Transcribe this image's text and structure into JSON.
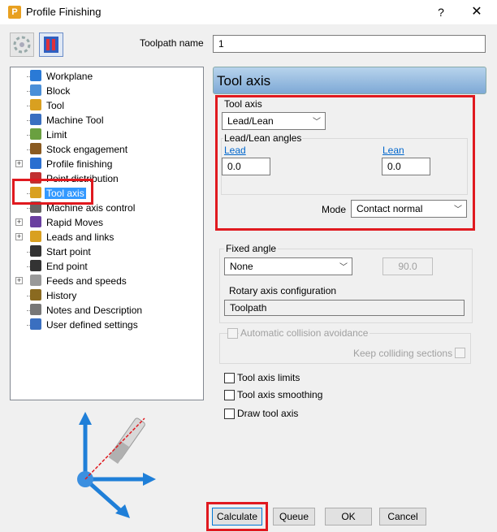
{
  "window": {
    "title": "Profile Finishing",
    "help_label": "?",
    "close_label": "✕",
    "app_icon_letter": "P"
  },
  "toolpath_name": {
    "label": "Toolpath name",
    "value": "1"
  },
  "tree": {
    "items": [
      {
        "label": "Workplane",
        "icon": "workplane-icon",
        "expandable": false
      },
      {
        "label": "Block",
        "icon": "block-icon",
        "expandable": false
      },
      {
        "label": "Tool",
        "icon": "tool-icon",
        "expandable": false
      },
      {
        "label": "Machine Tool",
        "icon": "machine-tool-icon",
        "expandable": false
      },
      {
        "label": "Limit",
        "icon": "limit-icon",
        "expandable": false
      },
      {
        "label": "Stock engagement",
        "icon": "stock-engagement-icon",
        "expandable": false
      },
      {
        "label": "Profile finishing",
        "icon": "profile-finishing-icon",
        "expandable": true
      },
      {
        "label": "Point distribution",
        "icon": "point-distribution-icon",
        "expandable": false
      },
      {
        "label": "Tool axis",
        "icon": "tool-axis-icon",
        "expandable": false,
        "selected": true
      },
      {
        "label": "Machine axis control",
        "icon": "machine-axis-control-icon",
        "expandable": false
      },
      {
        "label": "Rapid Moves",
        "icon": "rapid-moves-icon",
        "expandable": true
      },
      {
        "label": "Leads and links",
        "icon": "leads-links-icon",
        "expandable": true
      },
      {
        "label": "Start point",
        "icon": "start-point-icon",
        "expandable": false
      },
      {
        "label": "End point",
        "icon": "end-point-icon",
        "expandable": false
      },
      {
        "label": "Feeds and speeds",
        "icon": "feeds-speeds-icon",
        "expandable": true
      },
      {
        "label": "History",
        "icon": "history-icon",
        "expandable": false
      },
      {
        "label": "Notes and Description",
        "icon": "notes-icon",
        "expandable": false
      },
      {
        "label": "User defined settings",
        "icon": "user-settings-icon",
        "expandable": false
      }
    ]
  },
  "panel": {
    "header": "Tool axis",
    "tool_axis": {
      "label": "Tool axis",
      "value": "Lead/Lean"
    },
    "lead_lean": {
      "group_label": "Lead/Lean angles",
      "lead_label": "Lead",
      "lead_value": "0.0",
      "lean_label": "Lean",
      "lean_value": "0.0"
    },
    "mode": {
      "label": "Mode",
      "value": "Contact normal"
    },
    "fixed_angle": {
      "group_label": "Fixed angle",
      "value": "None",
      "angle_value": "90.0"
    },
    "rotary": {
      "label": "Rotary axis configuration",
      "value": "Toolpath"
    },
    "collision": {
      "label": "Automatic collision avoidance",
      "keep_label": "Keep colliding sections"
    },
    "checkboxes": {
      "limits": "Tool axis limits",
      "smoothing": "Tool axis smoothing",
      "draw": "Draw tool axis"
    }
  },
  "buttons": {
    "calculate": "Calculate",
    "queue": "Queue",
    "ok": "OK",
    "cancel": "Cancel"
  },
  "colors": {
    "highlight": "#e0191f",
    "selection": "#3399ff",
    "header_gradient_top": "#b7d3ec",
    "header_gradient_bottom": "#7ea9d6"
  }
}
